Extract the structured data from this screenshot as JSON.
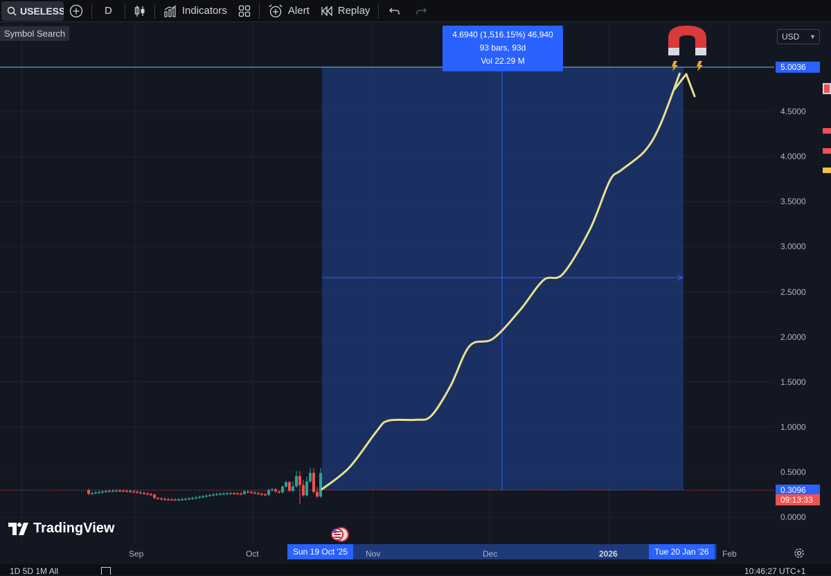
{
  "toolbar": {
    "symbol": "USELESS",
    "interval": "D",
    "indicators_label": "Indicators",
    "alert_label": "Alert",
    "replay_label": "Replay"
  },
  "tooltip": "Symbol Search",
  "currency": "USD",
  "measure": {
    "line1": "4.6940 (1,516.15%) 46,940",
    "line2": "93 bars, 93d",
    "line3": "Vol 22.29 M"
  },
  "price_axis": {
    "ticks": [
      "4.5000",
      "4.0000",
      "3.5000",
      "3.0000",
      "2.5000",
      "2.0000",
      "1.5000",
      "1.0000",
      "0.5000",
      "0.0000"
    ],
    "high_label": "5.0036",
    "last_price": "0.3096",
    "countdown": "09:13:33"
  },
  "time_axis": {
    "ticks": [
      {
        "label": "Sep",
        "bold": false
      },
      {
        "label": "Oct",
        "bold": false
      },
      {
        "label": "Nov",
        "bold": false
      },
      {
        "label": "Dec",
        "bold": false
      },
      {
        "label": "2026",
        "bold": true
      },
      {
        "label": "Feb",
        "bold": false
      }
    ],
    "start_label": "Sun 19 Oct '25",
    "end_label": "Tue 20 Jan '26"
  },
  "logo_text": "TradingView",
  "bottom_bar": {
    "left": "1D  5D  1M  All",
    "right": "10:46:27 UTC+1"
  },
  "colors": {
    "background": "#131722",
    "accent": "#2962ff",
    "up_candle": "#26a69a",
    "down_candle": "#ef5350",
    "drawn_curve": "#e8e08c",
    "range_fill": "#1e3a7a"
  },
  "chart_data": {
    "type": "line",
    "title": "",
    "xlabel": "",
    "ylabel": "",
    "ylim": [
      0,
      5.0036
    ],
    "series": [
      {
        "values": [
          {
            "x": "2025-10-19",
            "y": 0.3096
          },
          {
            "x": "2025-10-26",
            "y": 0.55
          },
          {
            "x": "2025-11-02",
            "y": 0.95
          },
          {
            "x": "2025-11-05",
            "y": 1.07
          },
          {
            "x": "2025-11-12",
            "y": 1.08
          },
          {
            "x": "2025-11-16",
            "y": 1.12
          },
          {
            "x": "2025-11-21",
            "y": 1.45
          },
          {
            "x": "2025-11-26",
            "y": 1.9
          },
          {
            "x": "2025-12-02",
            "y": 1.98
          },
          {
            "x": "2025-12-09",
            "y": 2.3
          },
          {
            "x": "2025-12-15",
            "y": 2.63
          },
          {
            "x": "2025-12-20",
            "y": 2.7
          },
          {
            "x": "2025-12-27",
            "y": 3.2
          },
          {
            "x": "2026-01-01",
            "y": 3.73
          },
          {
            "x": "2026-01-04",
            "y": 3.85
          },
          {
            "x": "2026-01-10",
            "y": 4.06
          },
          {
            "x": "2026-01-14",
            "y": 4.35
          },
          {
            "x": "2026-01-19",
            "y": 4.92
          }
        ]
      }
    ]
  }
}
